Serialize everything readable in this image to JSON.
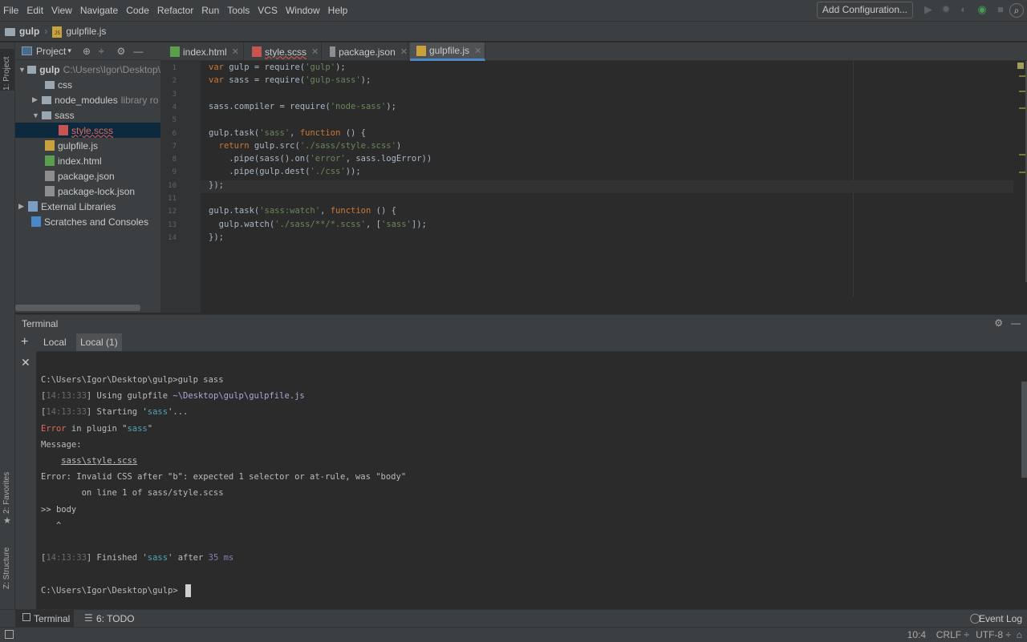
{
  "menu": [
    "File",
    "Edit",
    "View",
    "Navigate",
    "Code",
    "Refactor",
    "Run",
    "Tools",
    "VCS",
    "Window",
    "Help"
  ],
  "breadcrumb": {
    "project": "gulp",
    "file": "gulpfile.js"
  },
  "toolbar": {
    "add_config": "Add Configuration..."
  },
  "leftstrip": {
    "project": "1: Project",
    "favorites": "2: Favorites",
    "structure": "Z: Structure"
  },
  "project_panel": {
    "title": "Project",
    "tree": [
      {
        "label": "gulp",
        "extra": "C:\\Users\\Igor\\Desktop\\",
        "type": "folder",
        "depth": 0,
        "expanded": true
      },
      {
        "label": "css",
        "type": "folder",
        "depth": 1
      },
      {
        "label": "node_modules",
        "extra": "library ro",
        "type": "folder",
        "depth": 1,
        "collapsed": true
      },
      {
        "label": "sass",
        "type": "folder",
        "depth": 1,
        "expanded": true
      },
      {
        "label": "style.scss",
        "type": "scss",
        "depth": 2,
        "selected": true
      },
      {
        "label": "gulpfile.js",
        "type": "js",
        "depth": 1
      },
      {
        "label": "index.html",
        "type": "html",
        "depth": 1
      },
      {
        "label": "package.json",
        "type": "json",
        "depth": 1
      },
      {
        "label": "package-lock.json",
        "type": "json",
        "depth": 1
      },
      {
        "label": "External Libraries",
        "type": "lib",
        "depth": 0,
        "collapsed": true
      },
      {
        "label": "Scratches and Consoles",
        "type": "scratch",
        "depth": 0
      }
    ]
  },
  "editor_tabs": [
    {
      "label": "index.html",
      "type": "html"
    },
    {
      "label": "style.scss",
      "type": "scss"
    },
    {
      "label": "package.json",
      "type": "json"
    },
    {
      "label": "gulpfile.js",
      "type": "js",
      "active": true
    }
  ],
  "code_lines": [
    "var gulp = require('gulp');",
    "var sass = require('gulp-sass');",
    "",
    "sass.compiler = require('node-sass');",
    "",
    "gulp.task('sass', function () {",
    "  return gulp.src('./sass/style.scss')",
    "    .pipe(sass().on('error', sass.logError))",
    "    .pipe(gulp.dest('./css'));",
    "});",
    "",
    "gulp.task('sass:watch', function () {",
    "  gulp.watch('./sass/**/*.scss', ['sass']);",
    "});"
  ],
  "line_numbers": [
    "1",
    "2",
    "3",
    "4",
    "5",
    "6",
    "7",
    "8",
    "9",
    "10",
    "11",
    "12",
    "13",
    "14"
  ],
  "terminal": {
    "title": "Terminal",
    "tabs": [
      "Local",
      "Local (1)"
    ],
    "lines": [
      "C:\\Users\\Igor\\Desktop\\gulp>gulp sass",
      "[14:13:33] Using gulpfile ~\\Desktop\\gulp\\gulpfile.js",
      "[14:13:33] Starting 'sass'...",
      "Error in plugin \"sass\"",
      "Message:",
      "    sass\\style.scss",
      "Error: Invalid CSS after \"b\": expected 1 selector or at-rule, was \"body\"",
      "        on line 1 of sass/style.scss",
      ">> body",
      "   ^",
      "",
      "[14:13:33] Finished 'sass' after 35 ms",
      "",
      "C:\\Users\\Igor\\Desktop\\gulp>"
    ]
  },
  "bottom_tabs": {
    "terminal": "Terminal",
    "todo": "6: TODO",
    "event_log": "Event Log"
  },
  "status": {
    "position": "10:4",
    "line_sep": "CRLF ÷",
    "encoding": "UTF-8 ÷"
  }
}
